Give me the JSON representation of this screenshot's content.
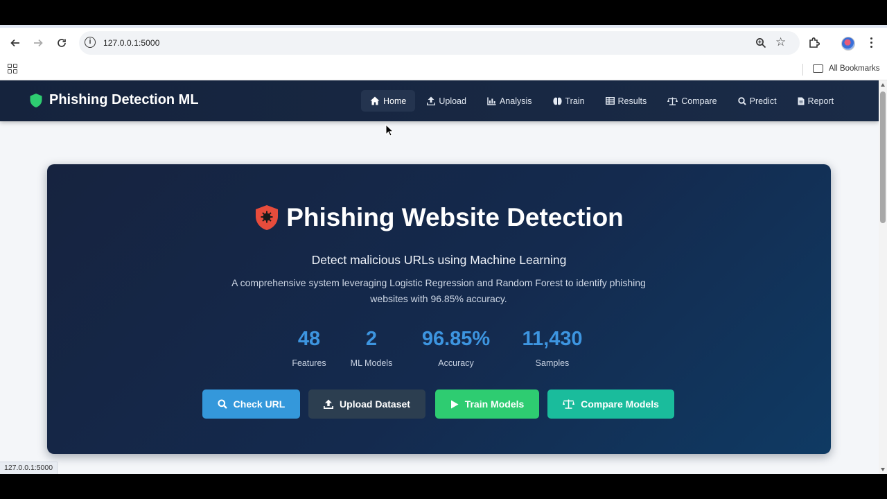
{
  "browser": {
    "url": "127.0.0.1:5000",
    "bookmarks_label": "All Bookmarks",
    "status_url": "127.0.0.1:5000"
  },
  "navbar": {
    "brand": "Phishing Detection ML",
    "links": [
      {
        "label": "Home",
        "icon": "home-icon"
      },
      {
        "label": "Upload",
        "icon": "upload-icon"
      },
      {
        "label": "Analysis",
        "icon": "chart-icon"
      },
      {
        "label": "Train",
        "icon": "brain-icon"
      },
      {
        "label": "Results",
        "icon": "table-icon"
      },
      {
        "label": "Compare",
        "icon": "scale-icon"
      },
      {
        "label": "Predict",
        "icon": "search-icon"
      },
      {
        "label": "Report",
        "icon": "document-icon"
      }
    ]
  },
  "hero": {
    "title": "Phishing Website Detection",
    "subtitle": "Detect malicious URLs using Machine Learning",
    "description": "A comprehensive system leveraging Logistic Regression and Random Forest to identify phishing websites with 96.85% accuracy.",
    "stats": [
      {
        "value": "48",
        "label": "Features"
      },
      {
        "value": "2",
        "label": "ML Models"
      },
      {
        "value": "96.85%",
        "label": "Accuracy"
      },
      {
        "value": "11,430",
        "label": "Samples"
      }
    ],
    "buttons": [
      {
        "label": "Check URL",
        "icon": "search-icon",
        "color": "#3498db"
      },
      {
        "label": "Upload Dataset",
        "icon": "upload-icon",
        "color": "#2c3e50"
      },
      {
        "label": "Train Models",
        "icon": "play-icon",
        "color": "#2ecc71"
      },
      {
        "label": "Compare Models",
        "icon": "scale-icon",
        "color": "#1abc9c"
      }
    ]
  },
  "colors": {
    "accent": "#3d95e0",
    "navbar": "#15233d",
    "brand_shield": "#2ecc71",
    "title_shield": "#e74c3c"
  }
}
